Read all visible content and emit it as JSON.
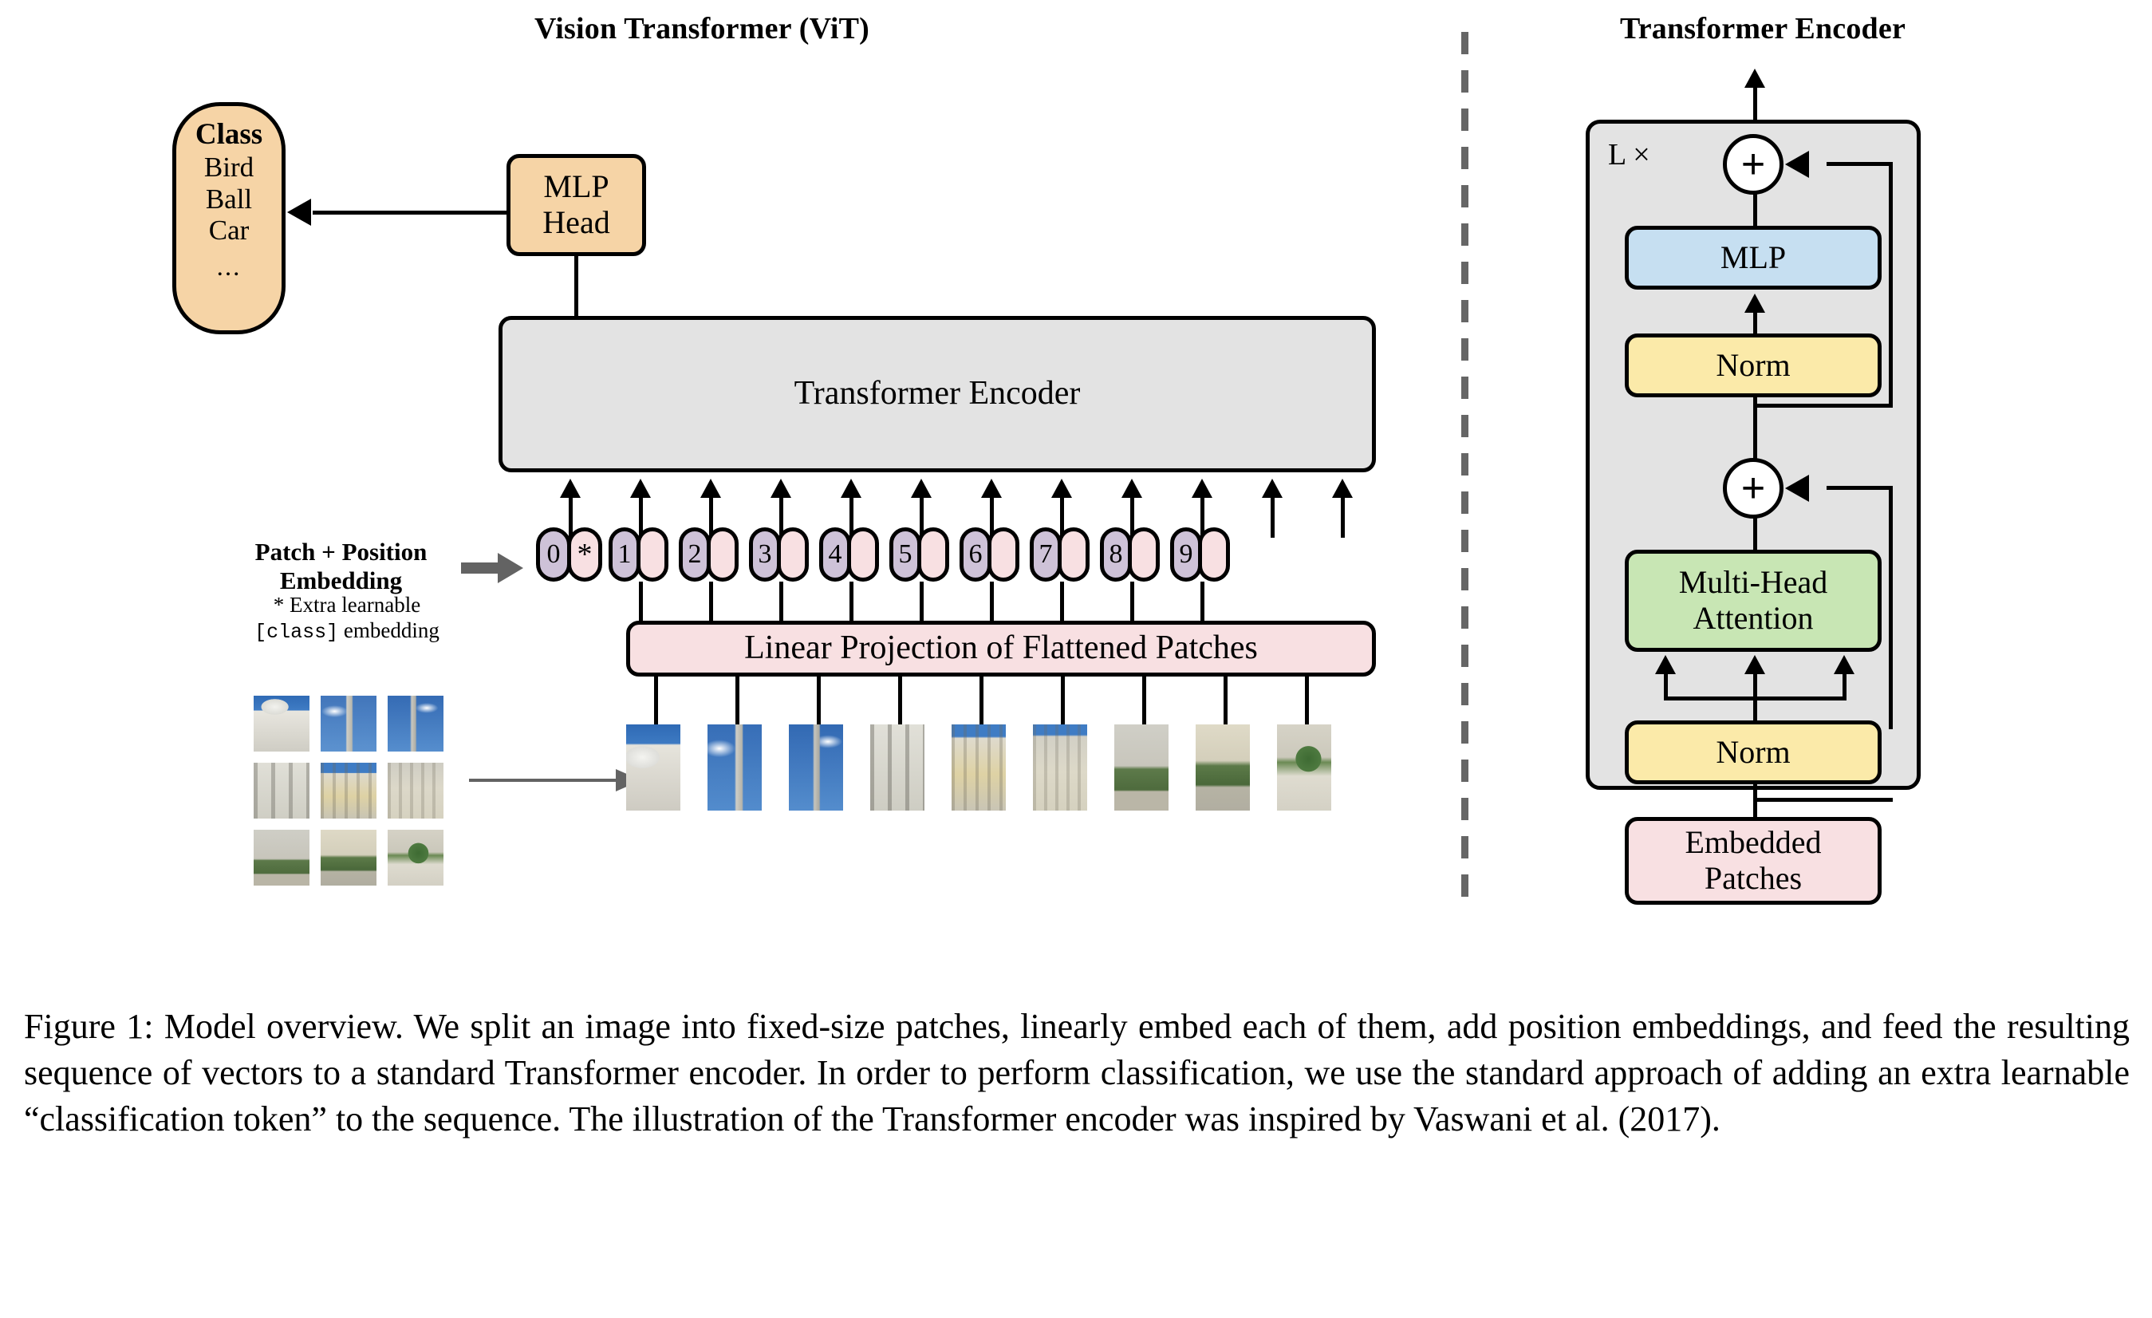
{
  "figure": {
    "left_panel_title": "Vision Transformer (ViT)",
    "right_panel_title": "Transformer Encoder"
  },
  "left_panel": {
    "class_box": {
      "title": "Class",
      "items": [
        "Bird",
        "Ball",
        "Car"
      ],
      "ellipsis": "..."
    },
    "mlp_head": "MLP\nHead",
    "mlp_head_line1": "MLP",
    "mlp_head_line2": "Head",
    "encoder_box_label": "Transformer Encoder",
    "embedding_label_line1": "Patch + Position",
    "embedding_label_line2": "Embedding",
    "footnote_line1": "* Extra learnable",
    "footnote_mono": "[class]",
    "footnote_line2_tail": " embedding",
    "linear_projection_label": "Linear Projection of Flattened Patches",
    "tokens": [
      {
        "pos": "0",
        "star": "*"
      },
      {
        "pos": "1"
      },
      {
        "pos": "2"
      },
      {
        "pos": "3"
      },
      {
        "pos": "4"
      },
      {
        "pos": "5"
      },
      {
        "pos": "6"
      },
      {
        "pos": "7"
      },
      {
        "pos": "8"
      },
      {
        "pos": "9"
      }
    ]
  },
  "right_panel": {
    "repeat_label": "L ×",
    "mlp": "MLP",
    "norm_top": "Norm",
    "attention_line1": "Multi-Head",
    "attention_line2": "Attention",
    "norm_bottom": "Norm",
    "embedded_patches_line1": "Embedded",
    "embedded_patches_line2": "Patches",
    "plus_symbol": "+"
  },
  "caption": {
    "text": "Figure 1: Model overview. We split an image into fixed-size patches, linearly embed each of them, add position embeddings, and feed the resulting sequence of vectors to a standard Transformer encoder. In order to perform classification, we use the standard approach of adding an extra learnable “classification token” to the sequence. The illustration of the Transformer encoder was inspired by Vaswani et al. (2017)."
  },
  "colors": {
    "orange": "#f6d4a6",
    "grey": "#e3e3e3",
    "pink": "#f8e0e2",
    "blue": "#c6dff1",
    "yellow": "#fbeaa9",
    "green": "#c8e6b4",
    "position_pill": "#cec2d8",
    "divider": "#666666",
    "stroke": "#000000"
  }
}
